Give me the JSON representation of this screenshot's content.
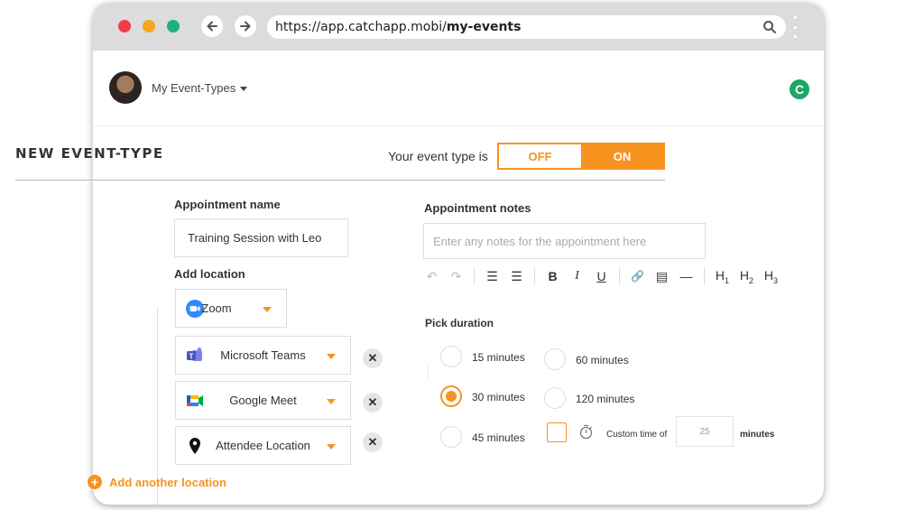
{
  "browser": {
    "url_prefix": "https://app.catchapp.mobi/",
    "url_path": "my-events",
    "colors": {
      "close": "#ee3c4a",
      "minimize": "#f7a51c",
      "maximize": "#1fb17d"
    }
  },
  "nav": {
    "menu_label": "My Event-Types",
    "brand_icon_glyph": "C"
  },
  "header": {
    "title": "NEW EVENT-TYPE",
    "status_label": "Your event type is",
    "toggle_off": "OFF",
    "toggle_on": "ON",
    "toggle_state": "on"
  },
  "form": {
    "appointment_name_label": "Appointment name",
    "appointment_name_value": "Training Session with Leo",
    "add_location_label": "Add location",
    "primary_location": "Zoom",
    "locations": [
      "Microsoft Teams",
      "Google Meet",
      "Attendee Location"
    ],
    "remove_glyph": "✕",
    "add_another_label": "Add another location",
    "plus_glyph": "+",
    "notes_label": "Appointment notes",
    "notes_placeholder": "Enter any notes for the appointment here",
    "toolbar": {
      "undo": "↶",
      "redo": "↷",
      "ordered_list": "☰",
      "bullet_list": "☰",
      "bold": "B",
      "italic": "I",
      "underline": "U",
      "link": "🔗",
      "doc": "▤",
      "rule": "—",
      "h": "H",
      "h1": "1",
      "h2": "2",
      "h3": "3"
    },
    "duration_label": "Pick duration",
    "durations": [
      "15 minutes",
      "30 minutes",
      "45 minutes",
      "60 minutes",
      "120 minutes"
    ],
    "selected_duration": "30 minutes",
    "custom_label": "Custom time of",
    "custom_value": "25",
    "custom_unit": "minutes"
  },
  "colors": {
    "accent": "#f7931e"
  }
}
